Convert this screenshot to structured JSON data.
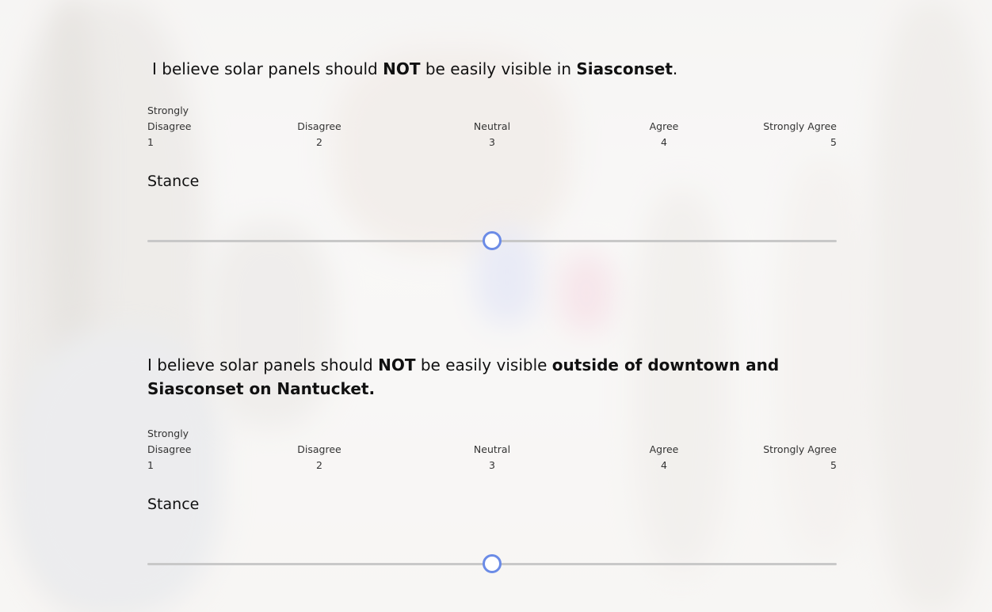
{
  "theme": {
    "accent": "#6b8be6",
    "track": "#c8c8c8"
  },
  "questions": [
    {
      "parts": [
        {
          "text": "I believe solar panels should ",
          "bold": false
        },
        {
          "text": "NOT",
          "bold": true
        },
        {
          "text": " be easily visible in ",
          "bold": false
        },
        {
          "text": "Siasconset",
          "bold": true
        },
        {
          "text": ".",
          "bold": false
        }
      ],
      "scale": [
        {
          "label": "Strongly Disagree",
          "value": "1"
        },
        {
          "label": "Disagree",
          "value": "2"
        },
        {
          "label": "Neutral",
          "value": "3"
        },
        {
          "label": "Agree",
          "value": "4"
        },
        {
          "label": "Strongly Agree",
          "value": "5"
        }
      ],
      "slider_label": "Stance",
      "slider_value": 3,
      "slider_min": 1,
      "slider_max": 5
    },
    {
      "parts": [
        {
          "text": "I believe solar panels should ",
          "bold": false
        },
        {
          "text": "NOT",
          "bold": true
        },
        {
          "text": " be easily visible ",
          "bold": false
        },
        {
          "text": "outside of downtown and Siasconset on Nantucket.",
          "bold": true
        }
      ],
      "scale": [
        {
          "label": "Strongly Disagree",
          "value": "1"
        },
        {
          "label": "Disagree",
          "value": "2"
        },
        {
          "label": "Neutral",
          "value": "3"
        },
        {
          "label": "Agree",
          "value": "4"
        },
        {
          "label": "Strongly Agree",
          "value": "5"
        }
      ],
      "slider_label": "Stance",
      "slider_value": 3,
      "slider_min": 1,
      "slider_max": 5
    }
  ]
}
